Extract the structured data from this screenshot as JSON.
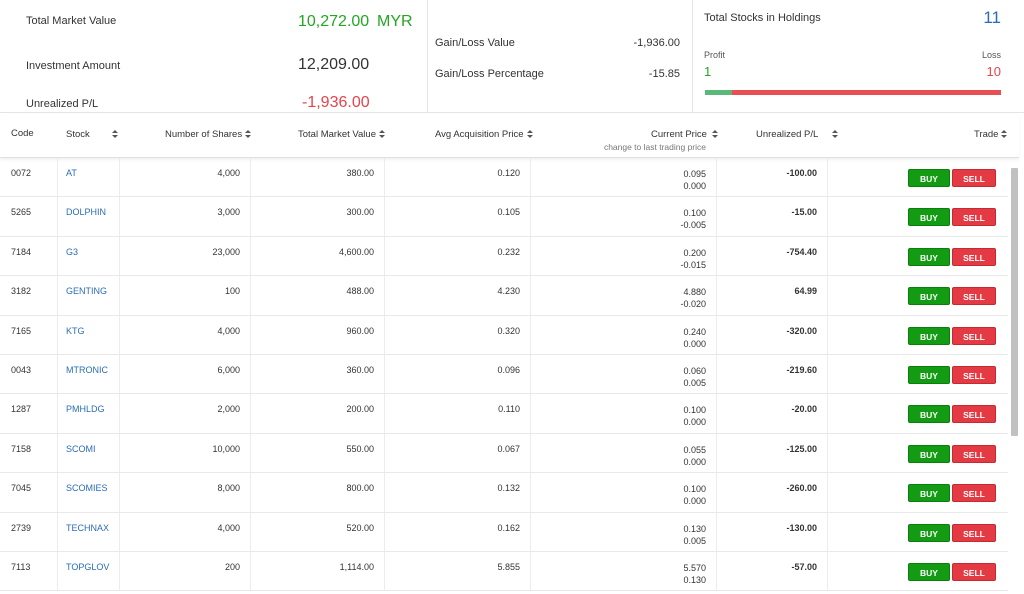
{
  "summary": {
    "total_market_value_label": "Total Market Value",
    "total_market_value": "10,272.00",
    "currency": "MYR",
    "investment_amount_label": "Investment Amount",
    "investment_amount": "12,209.00",
    "unrealized_pl_label": "Unrealized P/L",
    "unrealized_pl": "-1,936.00",
    "gain_loss_value_label": "Gain/Loss Value",
    "gain_loss_value": "-1,936.00",
    "gain_loss_pct_label": "Gain/Loss Percentage",
    "gain_loss_pct": "-15.85",
    "total_stocks_label": "Total Stocks in Holdings",
    "total_stocks": "11",
    "profit_label": "Profit",
    "profit_count": "1",
    "loss_label": "Loss",
    "loss_count": "10",
    "profit_fraction": 0.09,
    "colors": {
      "profit": "#21a821",
      "loss": "#e8434c",
      "accent": "#2b6cb8"
    }
  },
  "table": {
    "headers": {
      "code": "Code",
      "stock": "Stock",
      "shares": "Number of Shares",
      "market_value": "Total Market Value",
      "avg_price": "Avg Acquisition Price",
      "current_price": "Current Price",
      "current_price_sub": "change to last trading price",
      "upl": "Unrealized P/L",
      "trade": "Trade"
    },
    "buy_label": "BUY",
    "sell_label": "SELL",
    "rows": [
      {
        "code": "0072",
        "stock": "AT",
        "shares": "4,000",
        "mv": "380.00",
        "avg": "0.120",
        "cur": "0.095",
        "chg": "0.000",
        "upl": "-100.00"
      },
      {
        "code": "5265",
        "stock": "DOLPHIN",
        "shares": "3,000",
        "mv": "300.00",
        "avg": "0.105",
        "cur": "0.100",
        "chg": "-0.005",
        "upl": "-15.00"
      },
      {
        "code": "7184",
        "stock": "G3",
        "shares": "23,000",
        "mv": "4,600.00",
        "avg": "0.232",
        "cur": "0.200",
        "chg": "-0.015",
        "upl": "-754.40"
      },
      {
        "code": "3182",
        "stock": "GENTING",
        "shares": "100",
        "mv": "488.00",
        "avg": "4.230",
        "cur": "4.880",
        "chg": "-0.020",
        "upl": "64.99"
      },
      {
        "code": "7165",
        "stock": "KTG",
        "shares": "4,000",
        "mv": "960.00",
        "avg": "0.320",
        "cur": "0.240",
        "chg": "0.000",
        "upl": "-320.00"
      },
      {
        "code": "0043",
        "stock": "MTRONIC",
        "shares": "6,000",
        "mv": "360.00",
        "avg": "0.096",
        "cur": "0.060",
        "chg": "0.005",
        "upl": "-219.60"
      },
      {
        "code": "1287",
        "stock": "PMHLDG",
        "shares": "2,000",
        "mv": "200.00",
        "avg": "0.110",
        "cur": "0.100",
        "chg": "0.000",
        "upl": "-20.00"
      },
      {
        "code": "7158",
        "stock": "SCOMI",
        "shares": "10,000",
        "mv": "550.00",
        "avg": "0.067",
        "cur": "0.055",
        "chg": "0.000",
        "upl": "-125.00"
      },
      {
        "code": "7045",
        "stock": "SCOMIES",
        "shares": "8,000",
        "mv": "800.00",
        "avg": "0.132",
        "cur": "0.100",
        "chg": "0.000",
        "upl": "-260.00"
      },
      {
        "code": "2739",
        "stock": "TECHNAX",
        "shares": "4,000",
        "mv": "520.00",
        "avg": "0.162",
        "cur": "0.130",
        "chg": "0.005",
        "upl": "-130.00"
      },
      {
        "code": "7113",
        "stock": "TOPGLOV",
        "shares": "200",
        "mv": "1,114.00",
        "avg": "5.855",
        "cur": "5.570",
        "chg": "0.130",
        "upl": "-57.00"
      }
    ]
  }
}
